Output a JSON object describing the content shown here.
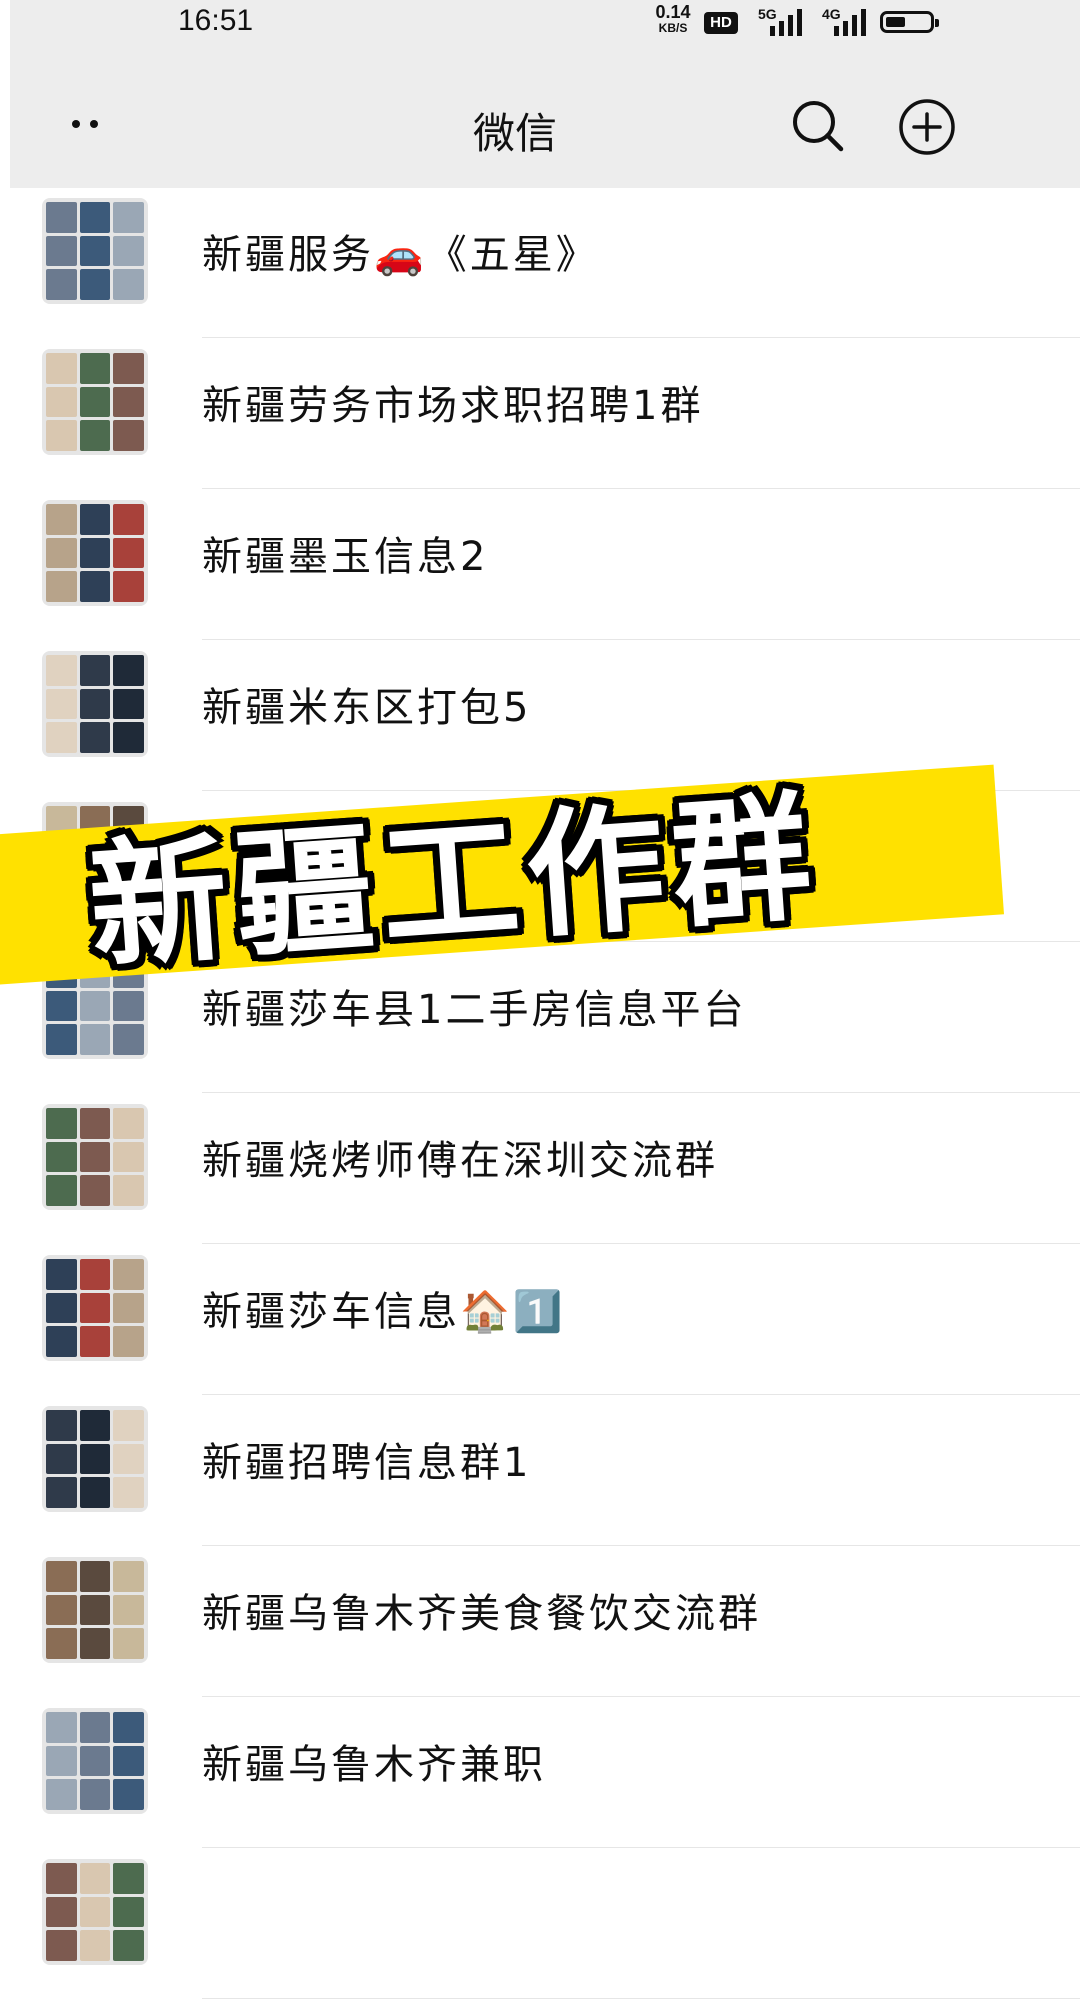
{
  "status_bar": {
    "time": "16:51",
    "net_speed_value": "0.14",
    "net_speed_unit": "KB/S",
    "hd_badge": "HD",
    "signal_1_label": "5G",
    "signal_2_label": "4G",
    "battery_level": 0.45
  },
  "header": {
    "title": "微信",
    "more_icon": "more-dots-icon",
    "search_icon": "search-icon",
    "add_icon": "add-circle-icon"
  },
  "chats": [
    {
      "name": "新疆服务🚗《五星》"
    },
    {
      "name": "新疆劳务市场求职招聘1群"
    },
    {
      "name": "新疆墨玉信息2"
    },
    {
      "name": "新疆米东区打包5"
    },
    {
      "name": ""
    },
    {
      "name": "新疆莎车县1二手房信息平台"
    },
    {
      "name": "新疆烧烤师傅在深圳交流群"
    },
    {
      "name": "新疆莎车信息🏠1️⃣"
    },
    {
      "name": "新疆招聘信息群1"
    },
    {
      "name": "新疆乌鲁木齐美食餐饮交流群"
    },
    {
      "name": "新疆乌鲁木齐兼职"
    },
    {
      "name": ""
    }
  ],
  "overlay": {
    "banner_text": "新疆工作群",
    "banner_color": "#ffe100"
  }
}
